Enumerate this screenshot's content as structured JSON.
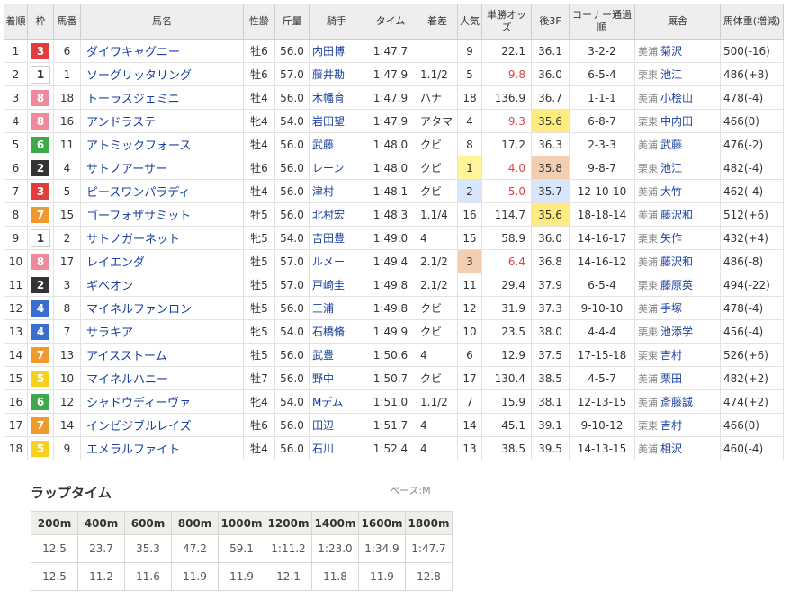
{
  "headers": {
    "rank": "着順",
    "frame": "枠",
    "num": "馬番",
    "horse": "馬名",
    "sex_age": "性齢",
    "weight": "斤量",
    "jockey": "騎手",
    "time": "タイム",
    "margin": "着差",
    "pop": "人気",
    "odds": "単勝オッズ",
    "last3f": "後3F",
    "corner": "コーナー通過順",
    "stable": "厩舎",
    "body_weight": "馬体重(増減)"
  },
  "rows": [
    {
      "rank": "1",
      "frame": "3",
      "frame_color": "#e23c3c",
      "frame_text": "#ffffff",
      "num": "6",
      "horse": "ダイワキャグニー",
      "sex_age": "牡6",
      "weight": "56.0",
      "jockey": "内田博",
      "time": "1:47.7",
      "margin": "",
      "pop": "9",
      "pop_rank": 0,
      "odds": "22.1",
      "odds_low": false,
      "last3f": "36.1",
      "last3f_rank": 0,
      "corner": "3-2-2",
      "aff": "美浦",
      "trainer": "菊沢",
      "body_weight": "500(-16)"
    },
    {
      "rank": "2",
      "frame": "1",
      "frame_color": "#ffffff",
      "frame_text": "#333333",
      "num": "1",
      "horse": "ソーグリッタリング",
      "sex_age": "牡6",
      "weight": "57.0",
      "jockey": "藤井勘",
      "time": "1:47.9",
      "margin": "1.1/2",
      "pop": "5",
      "pop_rank": 0,
      "odds": "9.8",
      "odds_low": true,
      "last3f": "36.0",
      "last3f_rank": 0,
      "corner": "6-5-4",
      "aff": "栗東",
      "trainer": "池江",
      "body_weight": "486(+8)"
    },
    {
      "rank": "3",
      "frame": "8",
      "frame_color": "#f08a9a",
      "frame_text": "#ffffff",
      "num": "18",
      "horse": "トーラスジェミニ",
      "sex_age": "牡4",
      "weight": "56.0",
      "jockey": "木幡育",
      "time": "1:47.9",
      "margin": "ハナ",
      "pop": "18",
      "pop_rank": 0,
      "odds": "136.9",
      "odds_low": false,
      "last3f": "36.7",
      "last3f_rank": 0,
      "corner": "1-1-1",
      "aff": "美浦",
      "trainer": "小桧山",
      "body_weight": "478(-4)"
    },
    {
      "rank": "4",
      "frame": "8",
      "frame_color": "#f08a9a",
      "frame_text": "#ffffff",
      "num": "16",
      "horse": "アンドラステ",
      "sex_age": "牝4",
      "weight": "54.0",
      "jockey": "岩田望",
      "time": "1:47.9",
      "margin": "アタマ",
      "pop": "4",
      "pop_rank": 0,
      "odds": "9.3",
      "odds_low": true,
      "last3f": "35.6",
      "last3f_rank": 1,
      "corner": "6-8-7",
      "aff": "栗東",
      "trainer": "中内田",
      "body_weight": "466(0)"
    },
    {
      "rank": "5",
      "frame": "6",
      "frame_color": "#3ea84b",
      "frame_text": "#ffffff",
      "num": "11",
      "horse": "アトミックフォース",
      "sex_age": "牡4",
      "weight": "56.0",
      "jockey": "武藤",
      "time": "1:48.0",
      "margin": "クビ",
      "pop": "8",
      "pop_rank": 0,
      "odds": "17.2",
      "odds_low": false,
      "last3f": "36.3",
      "last3f_rank": 0,
      "corner": "2-3-3",
      "aff": "美浦",
      "trainer": "武藤",
      "body_weight": "476(-2)"
    },
    {
      "rank": "6",
      "frame": "2",
      "frame_color": "#333333",
      "frame_text": "#ffffff",
      "num": "4",
      "horse": "サトノアーサー",
      "sex_age": "牡6",
      "weight": "56.0",
      "jockey": "レーン",
      "time": "1:48.0",
      "margin": "クビ",
      "pop": "1",
      "pop_rank": 1,
      "odds": "4.0",
      "odds_low": true,
      "last3f": "35.8",
      "last3f_rank": 3,
      "corner": "9-8-7",
      "aff": "栗東",
      "trainer": "池江",
      "body_weight": "482(-4)"
    },
    {
      "rank": "7",
      "frame": "3",
      "frame_color": "#e23c3c",
      "frame_text": "#ffffff",
      "num": "5",
      "horse": "ピースワンパラディ",
      "sex_age": "牡4",
      "weight": "56.0",
      "jockey": "津村",
      "time": "1:48.1",
      "margin": "クビ",
      "pop": "2",
      "pop_rank": 2,
      "odds": "5.0",
      "odds_low": true,
      "last3f": "35.7",
      "last3f_rank": 2,
      "corner": "12-10-10",
      "aff": "美浦",
      "trainer": "大竹",
      "body_weight": "462(-4)"
    },
    {
      "rank": "8",
      "frame": "7",
      "frame_color": "#f09a2e",
      "frame_text": "#ffffff",
      "num": "15",
      "horse": "ゴーフォザサミット",
      "sex_age": "牡5",
      "weight": "56.0",
      "jockey": "北村宏",
      "time": "1:48.3",
      "margin": "1.1/4",
      "pop": "16",
      "pop_rank": 0,
      "odds": "114.7",
      "odds_low": false,
      "last3f": "35.6",
      "last3f_rank": 1,
      "corner": "18-18-14",
      "aff": "美浦",
      "trainer": "藤沢和",
      "body_weight": "512(+6)"
    },
    {
      "rank": "9",
      "frame": "1",
      "frame_color": "#ffffff",
      "frame_text": "#333333",
      "num": "2",
      "horse": "サトノガーネット",
      "sex_age": "牝5",
      "weight": "54.0",
      "jockey": "吉田豊",
      "time": "1:49.0",
      "margin": "4",
      "pop": "15",
      "pop_rank": 0,
      "odds": "58.9",
      "odds_low": false,
      "last3f": "36.0",
      "last3f_rank": 0,
      "corner": "14-16-17",
      "aff": "栗東",
      "trainer": "矢作",
      "body_weight": "432(+4)"
    },
    {
      "rank": "10",
      "frame": "8",
      "frame_color": "#f08a9a",
      "frame_text": "#ffffff",
      "num": "17",
      "horse": "レイエンダ",
      "sex_age": "牡5",
      "weight": "57.0",
      "jockey": "ルメー",
      "time": "1:49.4",
      "margin": "2.1/2",
      "pop": "3",
      "pop_rank": 3,
      "odds": "6.4",
      "odds_low": true,
      "last3f": "36.8",
      "last3f_rank": 0,
      "corner": "14-16-12",
      "aff": "美浦",
      "trainer": "藤沢和",
      "body_weight": "486(-8)"
    },
    {
      "rank": "11",
      "frame": "2",
      "frame_color": "#333333",
      "frame_text": "#ffffff",
      "num": "3",
      "horse": "ギベオン",
      "sex_age": "牡5",
      "weight": "57.0",
      "jockey": "戸崎圭",
      "time": "1:49.8",
      "margin": "2.1/2",
      "pop": "11",
      "pop_rank": 0,
      "odds": "29.4",
      "odds_low": false,
      "last3f": "37.9",
      "last3f_rank": 0,
      "corner": "6-5-4",
      "aff": "栗東",
      "trainer": "藤原英",
      "body_weight": "494(-22)"
    },
    {
      "rank": "12",
      "frame": "4",
      "frame_color": "#3a6fcf",
      "frame_text": "#ffffff",
      "num": "8",
      "horse": "マイネルファンロン",
      "sex_age": "牡5",
      "weight": "56.0",
      "jockey": "三浦",
      "time": "1:49.8",
      "margin": "クビ",
      "pop": "12",
      "pop_rank": 0,
      "odds": "31.9",
      "odds_low": false,
      "last3f": "37.3",
      "last3f_rank": 0,
      "corner": "9-10-10",
      "aff": "美浦",
      "trainer": "手塚",
      "body_weight": "478(-4)"
    },
    {
      "rank": "13",
      "frame": "4",
      "frame_color": "#3a6fcf",
      "frame_text": "#ffffff",
      "num": "7",
      "horse": "サラキア",
      "sex_age": "牝5",
      "weight": "54.0",
      "jockey": "石橋脩",
      "time": "1:49.9",
      "margin": "クビ",
      "pop": "10",
      "pop_rank": 0,
      "odds": "23.5",
      "odds_low": false,
      "last3f": "38.0",
      "last3f_rank": 0,
      "corner": "4-4-4",
      "aff": "栗東",
      "trainer": "池添学",
      "body_weight": "456(-4)"
    },
    {
      "rank": "14",
      "frame": "7",
      "frame_color": "#f09a2e",
      "frame_text": "#ffffff",
      "num": "13",
      "horse": "アイスストーム",
      "sex_age": "牡5",
      "weight": "56.0",
      "jockey": "武豊",
      "time": "1:50.6",
      "margin": "4",
      "pop": "6",
      "pop_rank": 0,
      "odds": "12.9",
      "odds_low": false,
      "last3f": "37.5",
      "last3f_rank": 0,
      "corner": "17-15-18",
      "aff": "栗東",
      "trainer": "吉村",
      "body_weight": "526(+6)"
    },
    {
      "rank": "15",
      "frame": "5",
      "frame_color": "#f4d21f",
      "frame_text": "#ffffff",
      "num": "10",
      "horse": "マイネルハニー",
      "sex_age": "牡7",
      "weight": "56.0",
      "jockey": "野中",
      "time": "1:50.7",
      "margin": "クビ",
      "pop": "17",
      "pop_rank": 0,
      "odds": "130.4",
      "odds_low": false,
      "last3f": "38.5",
      "last3f_rank": 0,
      "corner": "4-5-7",
      "aff": "美浦",
      "trainer": "栗田",
      "body_weight": "482(+2)"
    },
    {
      "rank": "16",
      "frame": "6",
      "frame_color": "#3ea84b",
      "frame_text": "#ffffff",
      "num": "12",
      "horse": "シャドウディーヴァ",
      "sex_age": "牝4",
      "weight": "54.0",
      "jockey": "Mデム",
      "time": "1:51.0",
      "margin": "1.1/2",
      "pop": "7",
      "pop_rank": 0,
      "odds": "15.9",
      "odds_low": false,
      "last3f": "38.1",
      "last3f_rank": 0,
      "corner": "12-13-15",
      "aff": "美浦",
      "trainer": "斎藤誠",
      "body_weight": "474(+2)"
    },
    {
      "rank": "17",
      "frame": "7",
      "frame_color": "#f09a2e",
      "frame_text": "#ffffff",
      "num": "14",
      "horse": "インビジブルレイズ",
      "sex_age": "牡6",
      "weight": "56.0",
      "jockey": "田辺",
      "time": "1:51.7",
      "margin": "4",
      "pop": "14",
      "pop_rank": 0,
      "odds": "45.1",
      "odds_low": false,
      "last3f": "39.1",
      "last3f_rank": 0,
      "corner": "9-10-12",
      "aff": "栗東",
      "trainer": "吉村",
      "body_weight": "466(0)"
    },
    {
      "rank": "18",
      "frame": "5",
      "frame_color": "#f4d21f",
      "frame_text": "#ffffff",
      "num": "9",
      "horse": "エメラルファイト",
      "sex_age": "牡4",
      "weight": "56.0",
      "jockey": "石川",
      "time": "1:52.4",
      "margin": "4",
      "pop": "13",
      "pop_rank": 0,
      "odds": "38.5",
      "odds_low": false,
      "last3f": "39.5",
      "last3f_rank": 0,
      "corner": "14-13-15",
      "aff": "美浦",
      "trainer": "相沢",
      "body_weight": "460(-4)"
    }
  ],
  "lap": {
    "title": "ラップタイム",
    "pace": "ペース:M",
    "distances": [
      "200m",
      "400m",
      "600m",
      "800m",
      "1000m",
      "1200m",
      "1400m",
      "1600m",
      "1800m"
    ],
    "cumulative": [
      "12.5",
      "23.7",
      "35.3",
      "47.2",
      "59.1",
      "1:11.2",
      "1:23.0",
      "1:34.9",
      "1:47.7"
    ],
    "splits": [
      "12.5",
      "11.2",
      "11.6",
      "11.9",
      "11.9",
      "12.1",
      "11.8",
      "11.9",
      "12.8"
    ]
  }
}
